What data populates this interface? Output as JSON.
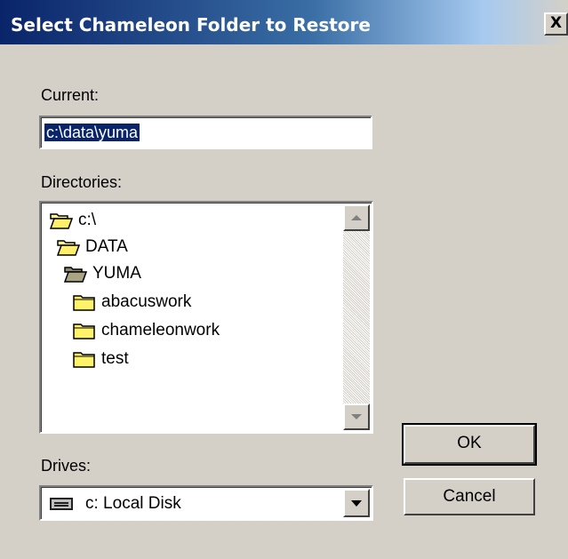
{
  "window": {
    "title": "Select Chameleon Folder to Restore",
    "close_label": "X"
  },
  "current": {
    "label": "Current:",
    "value": "c:\\data\\yuma"
  },
  "directories": {
    "label": "Directories:",
    "items": [
      {
        "label": "c:\\",
        "icon": "open-folder-icon"
      },
      {
        "label": "DATA",
        "icon": "open-folder-icon"
      },
      {
        "label": "YUMA",
        "icon": "open-folder-icon"
      },
      {
        "label": "abacuswork",
        "icon": "folder-icon"
      },
      {
        "label": "chameleonwork",
        "icon": "folder-icon"
      },
      {
        "label": "test",
        "icon": "folder-icon"
      }
    ]
  },
  "drives": {
    "label": "Drives:",
    "selected": "c: Local Disk",
    "icon": "hard-drive-icon"
  },
  "buttons": {
    "ok": "OK",
    "cancel": "Cancel"
  }
}
